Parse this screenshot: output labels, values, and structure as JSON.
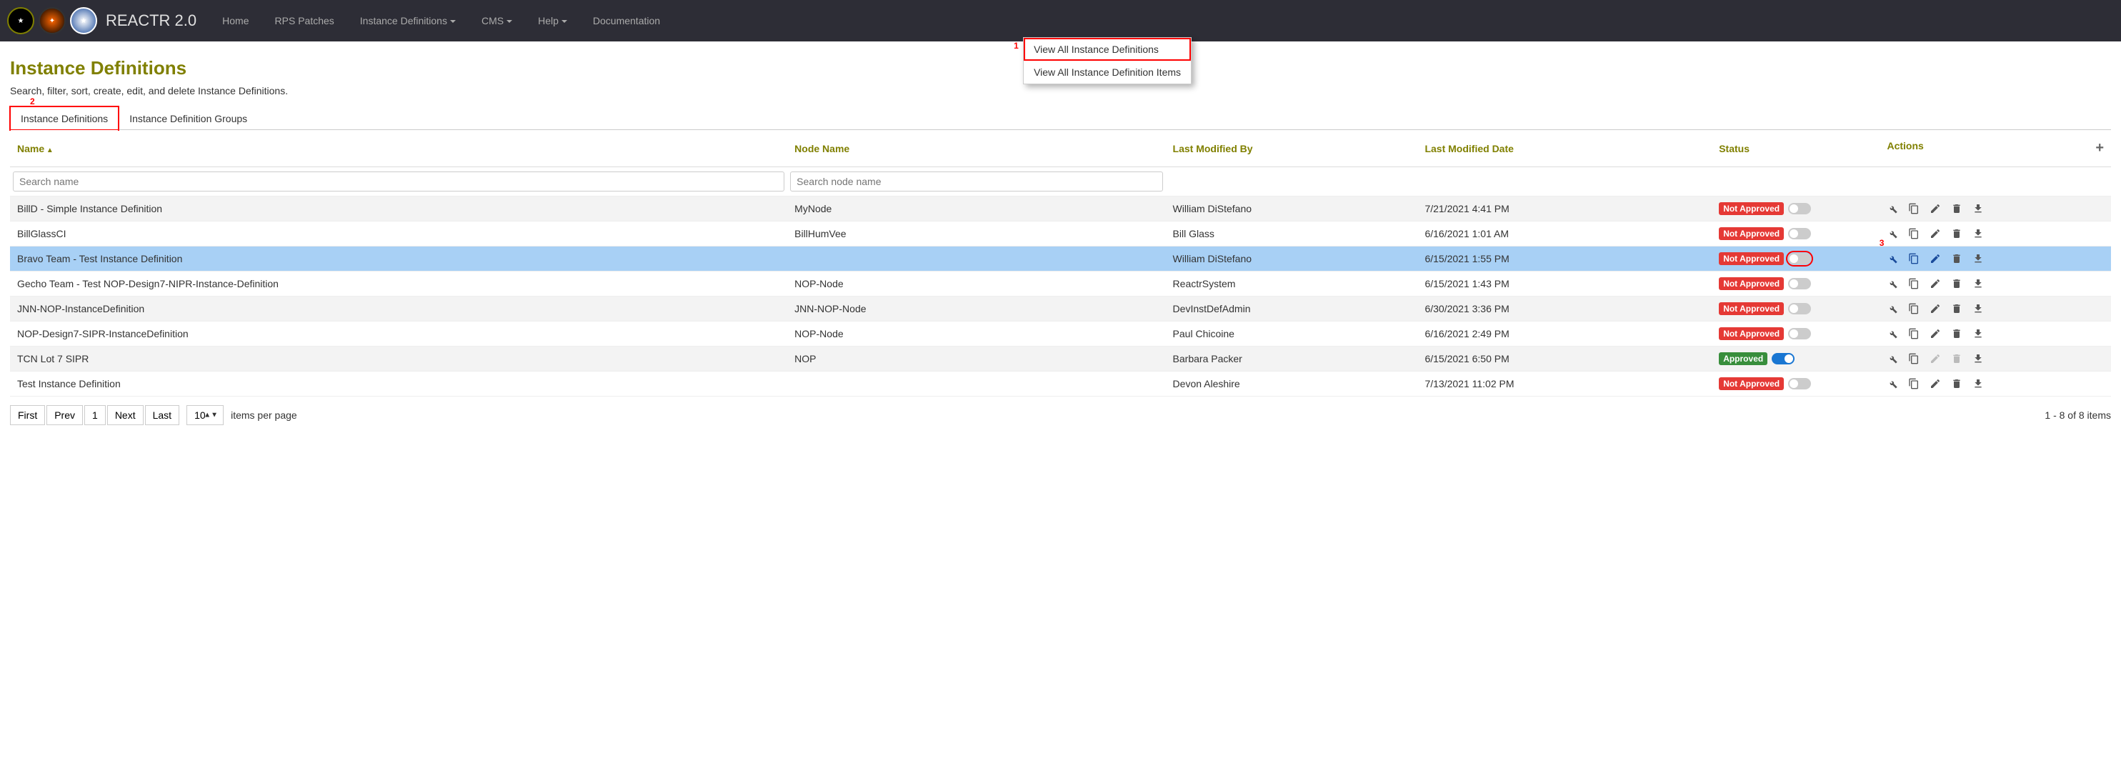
{
  "brand": "REACTR 2.0",
  "nav": {
    "home": "Home",
    "rps": "RPS Patches",
    "instdef": "Instance Definitions",
    "cms": "CMS",
    "help": "Help",
    "docs": "Documentation"
  },
  "dropdown": {
    "item1": "View All Instance Definitions",
    "item2": "View All Instance Definition Items"
  },
  "page": {
    "title": "Instance Definitions",
    "subtitle": "Search, filter, sort, create, edit, and delete Instance Definitions."
  },
  "tabs": {
    "tab1": "Instance Definitions",
    "tab2": "Instance Definition Groups"
  },
  "columns": {
    "name": "Name",
    "node": "Node Name",
    "modby": "Last Modified By",
    "moddate": "Last Modified Date",
    "status": "Status",
    "actions": "Actions"
  },
  "search": {
    "name_ph": "Search name",
    "node_ph": "Search node name"
  },
  "status_labels": {
    "approved": "Approved",
    "not_approved": "Not Approved"
  },
  "rows": [
    {
      "name": "BillD - Simple Instance Definition",
      "node": "MyNode",
      "modby": "William DiStefano",
      "moddate": "7/21/2021 4:41 PM",
      "approved": false,
      "toggle_on": false,
      "selected": false
    },
    {
      "name": "BillGlassCI",
      "node": "BillHumVee",
      "modby": "Bill Glass",
      "moddate": "6/16/2021 1:01 AM",
      "approved": false,
      "toggle_on": false,
      "selected": false
    },
    {
      "name": "Bravo Team - Test Instance Definition",
      "node": "",
      "modby": "William DiStefano",
      "moddate": "6/15/2021 1:55 PM",
      "approved": false,
      "toggle_on": false,
      "selected": true,
      "toggle_highlighted": true
    },
    {
      "name": "Gecho Team - Test NOP-Design7-NIPR-Instance-Definition",
      "node": "NOP-Node",
      "modby": "ReactrSystem",
      "moddate": "6/15/2021 1:43 PM",
      "approved": false,
      "toggle_on": false,
      "selected": false
    },
    {
      "name": "JNN-NOP-InstanceDefinition",
      "node": "JNN-NOP-Node",
      "modby": "DevInstDefAdmin",
      "moddate": "6/30/2021 3:36 PM",
      "approved": false,
      "toggle_on": false,
      "selected": false
    },
    {
      "name": "NOP-Design7-SIPR-InstanceDefinition",
      "node": "NOP-Node",
      "modby": "Paul Chicoine",
      "moddate": "6/16/2021 2:49 PM",
      "approved": false,
      "toggle_on": false,
      "selected": false
    },
    {
      "name": "TCN Lot 7 SIPR",
      "node": "NOP",
      "modby": "Barbara Packer",
      "moddate": "6/15/2021 6:50 PM",
      "approved": true,
      "toggle_on": true,
      "selected": false,
      "edit_disabled": true,
      "delete_disabled": true
    },
    {
      "name": "Test Instance Definition",
      "node": "",
      "modby": "Devon Aleshire",
      "moddate": "7/13/2021 11:02 PM",
      "approved": false,
      "toggle_on": false,
      "selected": false
    }
  ],
  "pager": {
    "first": "First",
    "prev": "Prev",
    "page": "1",
    "next": "Next",
    "last": "Last",
    "size": "10",
    "ipp": "items per page",
    "count": "1 - 8 of 8 items"
  },
  "callouts": {
    "c1": "1",
    "c2": "2",
    "c3": "3"
  }
}
